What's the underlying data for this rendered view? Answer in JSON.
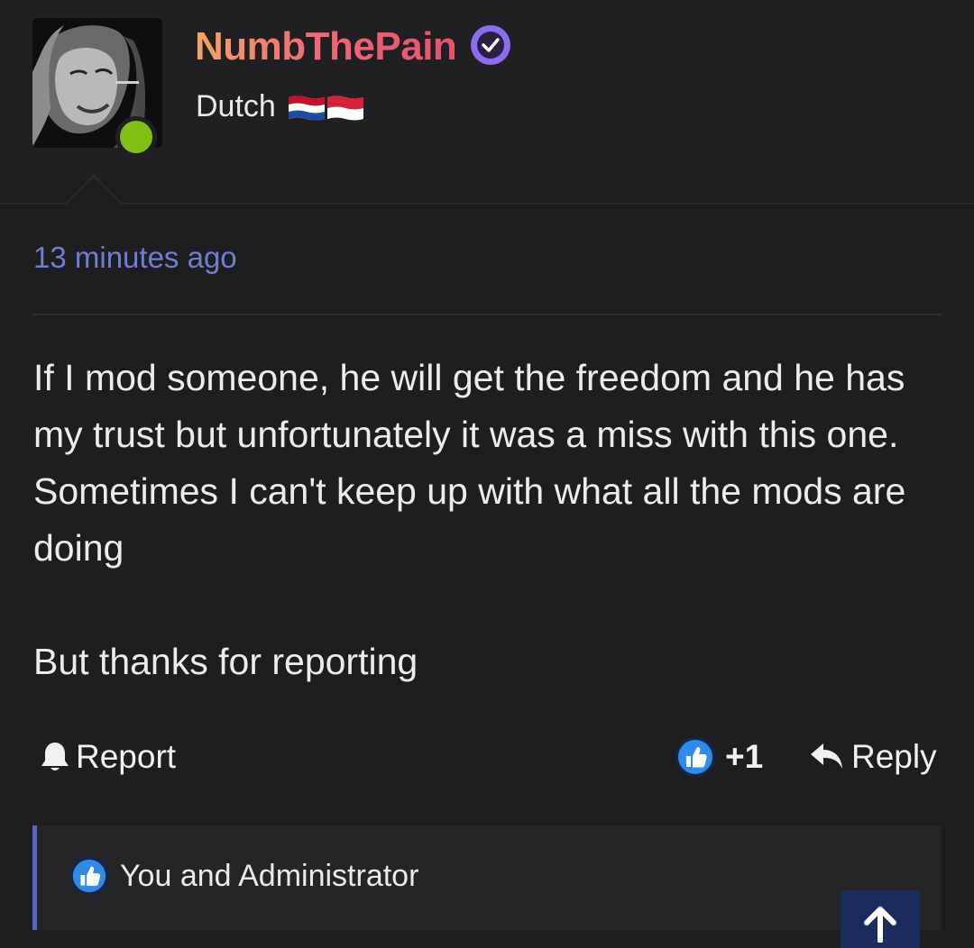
{
  "user": {
    "username": "NumbThePain",
    "title": "Dutch",
    "online": true,
    "verified": true,
    "name_gradient": [
      "#f3a565",
      "#e8516f"
    ]
  },
  "post": {
    "timestamp": "13 minutes ago",
    "paragraphs": [
      "If I mod someone, he will get the freedom and he has my trust but unfortunately it was a miss with this one. Sometimes I can't keep up with what all the mods are doing",
      "But thanks for reporting"
    ]
  },
  "actions": {
    "report_label": "Report",
    "like_count": "+1",
    "reply_label": "Reply"
  },
  "likes": {
    "text": "You and Administrator"
  },
  "colors": {
    "background": "#1e1e21",
    "accent": "#6f7ed0",
    "online": "#7fbf16",
    "verified": "#8b6cf3",
    "like": "#2f8be6"
  },
  "icons": {
    "verified": "check-circle-icon",
    "report": "bell-icon",
    "like": "thumbs-up-icon",
    "reply": "reply-arrow-icon",
    "scroll_top": "arrow-up-icon"
  }
}
